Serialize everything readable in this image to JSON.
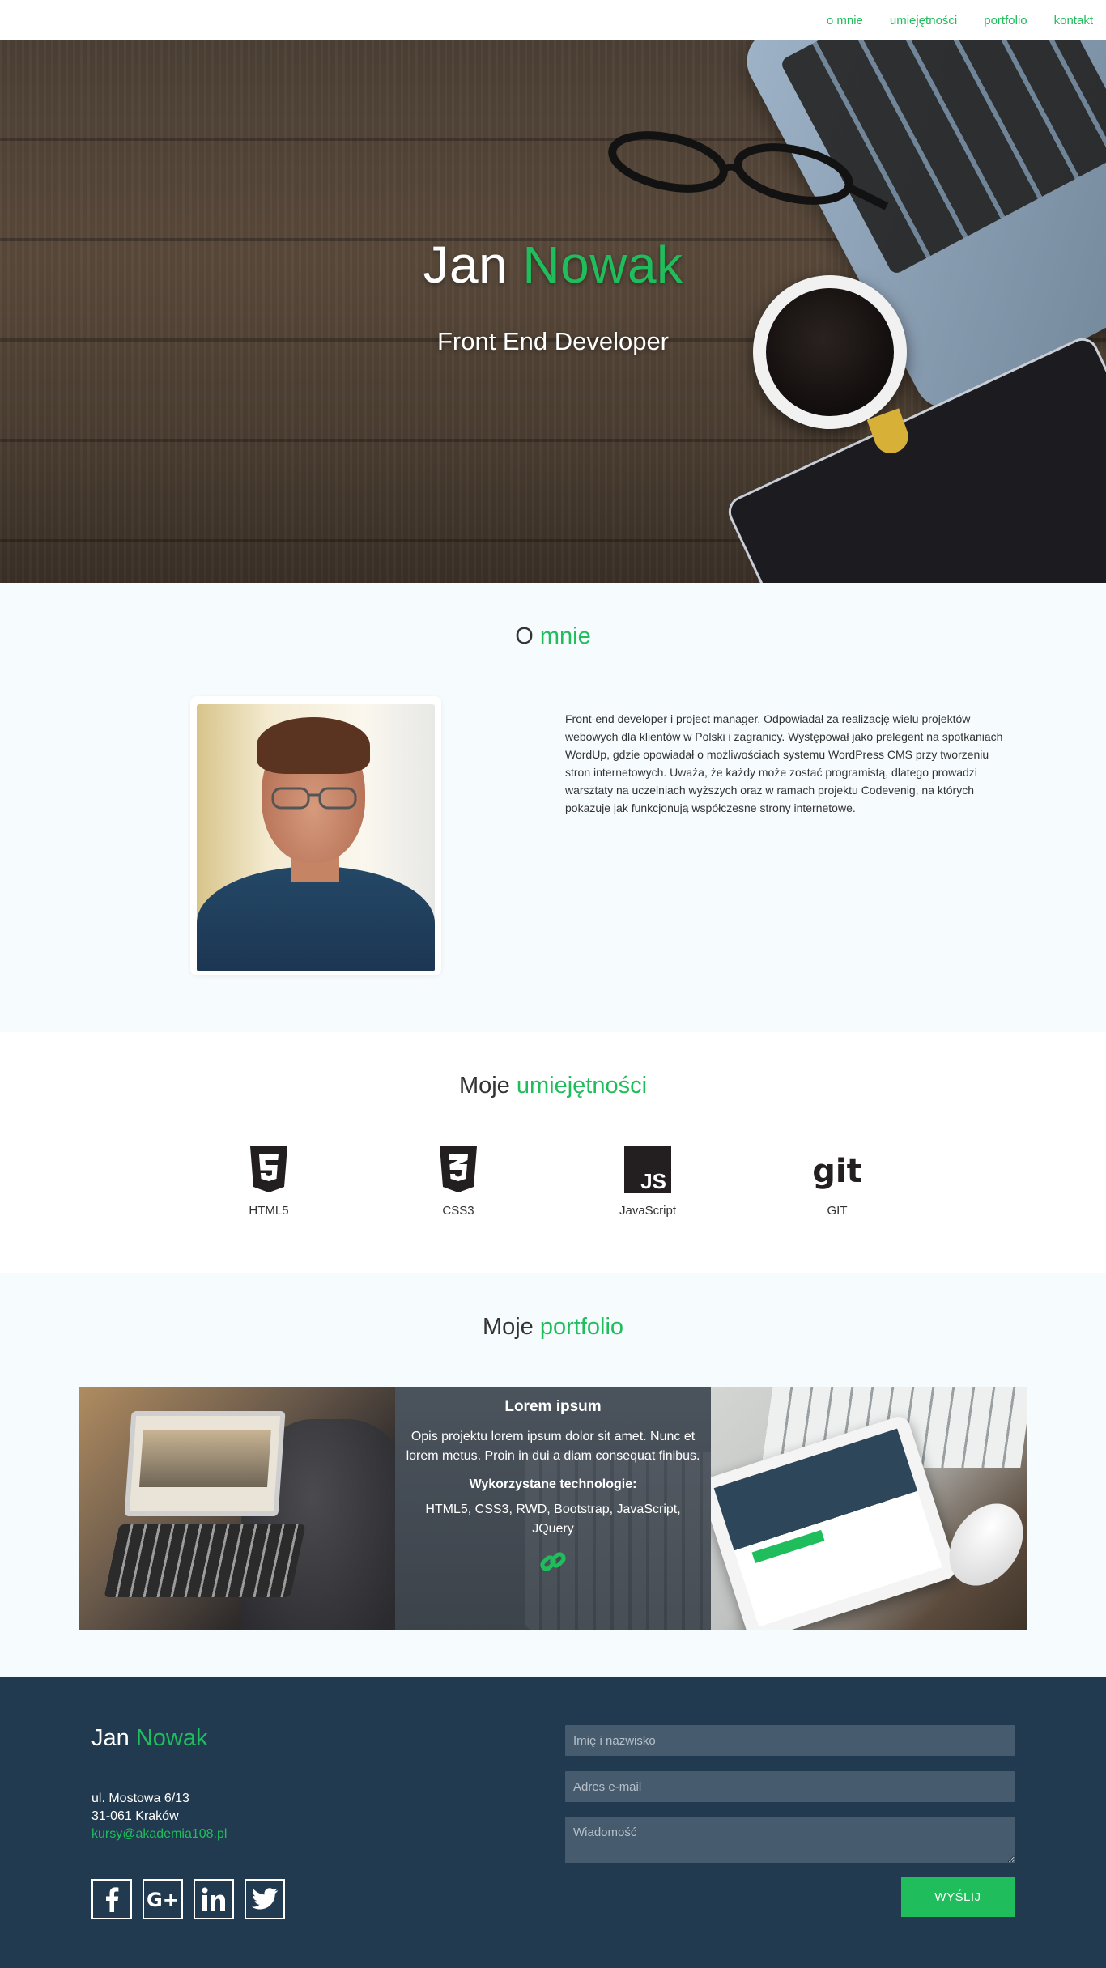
{
  "nav": {
    "items": [
      {
        "label": "o mnie"
      },
      {
        "label": "umiejętności"
      },
      {
        "label": "portfolio"
      },
      {
        "label": "kontakt"
      }
    ]
  },
  "hero": {
    "first_name": "Jan",
    "last_name": "Nowak",
    "subtitle": "Front End Developer"
  },
  "about": {
    "title_plain": "O",
    "title_accent": "mnie",
    "text": "Front-end developer i project manager. Odpowiadał za realizację wielu projektów webowych dla klientów w Polski i zagranicy. Występował jako prelegent na spotkaniach WordUp, gdzie opowiadał o możliwościach systemu WordPress CMS przy tworzeniu stron internetowych. Uważa, że każdy może zostać programistą, dlatego prowadzi warsztaty na uczelniach wyższych oraz w ramach projektu Codevenig, na których pokazuje jak funkcjonują współczesne strony internetowe."
  },
  "skills": {
    "title_plain": "Moje",
    "title_accent": "umiejętności",
    "items": [
      {
        "label": "HTML5",
        "icon": "html5-icon"
      },
      {
        "label": "CSS3",
        "icon": "css3-icon"
      },
      {
        "label": "JavaScript",
        "icon": "javascript-icon"
      },
      {
        "label": "GIT",
        "icon": "git-icon"
      }
    ]
  },
  "portfolio": {
    "title_plain": "Moje",
    "title_accent": "portfolio",
    "project": {
      "title": "Lorem ipsum",
      "description": "Opis projektu lorem ipsum dolor sit amet. Nunc et lorem metus. Proin in dui a diam consequat finibus.",
      "tech_label": "Wykorzystane technologie:",
      "tech": "HTML5, CSS3, RWD, Bootstrap, JavaScript, JQuery",
      "link_icon": "link-icon"
    }
  },
  "footer": {
    "first_name": "Jan",
    "last_name": "Nowak",
    "street": "ul. Mostowa 6/13",
    "city": "31-061 Kraków",
    "email": "kursy@akademia108.pl",
    "socials": [
      "facebook-icon",
      "google-plus-icon",
      "linkedin-icon",
      "twitter-icon"
    ],
    "form": {
      "name_placeholder": "Imię i nazwisko",
      "email_placeholder": "Adres e-mail",
      "message_placeholder": "Wiadomość",
      "submit_label": "WYŚLIJ"
    }
  },
  "colors": {
    "accent": "#1fbd5b",
    "footer_bg": "#223a50",
    "input_bg": "#465b6e",
    "section_bg": "#f6fbfd"
  }
}
